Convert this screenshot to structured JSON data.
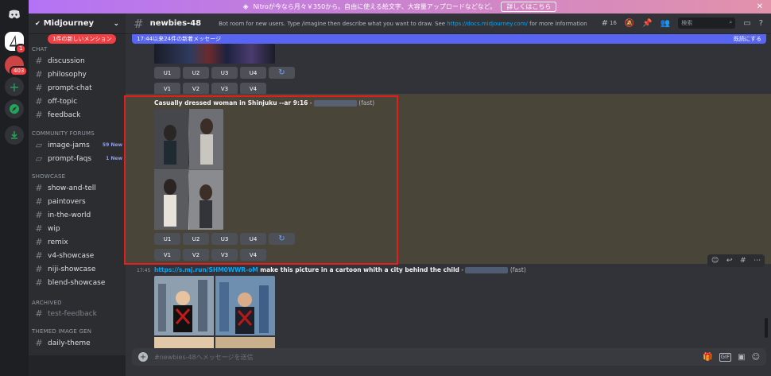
{
  "banner": {
    "nitro_icon": "nitro-icon",
    "text": "Nitroが今なら月々￥350から。自由に使える絵文字、大容量アップロードなどなど。",
    "cta": "詳しくはこちら",
    "close": "✕"
  },
  "guilds": {
    "badge_1": "1",
    "badge_2": "403"
  },
  "server": {
    "name": "Midjourney",
    "mention_pill": "1件の新しいメンション"
  },
  "sidebar": {
    "cat_chat": "CHAT",
    "ch_discussion": "discussion",
    "ch_philosophy": "philosophy",
    "ch_prompt_chat": "prompt-chat",
    "ch_off_topic": "off-topic",
    "ch_feedback": "feedback",
    "cat_forums": "COMMUNITY FORUMS",
    "ch_image_jams": "image-jams",
    "image_jams_new": "59 New",
    "ch_prompt_faqs": "prompt-faqs",
    "prompt_faqs_new": "1 New",
    "cat_showcase": "SHOWCASE",
    "ch_show_and_tell": "show-and-tell",
    "ch_paintovers": "paintovers",
    "ch_in_the_world": "in-the-world",
    "ch_wip": "wip",
    "ch_remix": "remix",
    "ch_v4_showcase": "v4-showcase",
    "ch_niji_showcase": "niji-showcase",
    "ch_blend_showcase": "blend-showcase",
    "cat_archived": "ARCHIVED",
    "ch_test_feedback": "test-feedback",
    "cat_themed": "THEMED IMAGE GEN",
    "ch_daily_theme": "daily-theme"
  },
  "channel": {
    "name": "newbies-48",
    "topic_pre": "Bot room for new users. Type /imagine then describe what you want to draw. See",
    "topic_link": "https://docs.midjourney.com/",
    "topic_post": "for more information",
    "thread_count": "16",
    "search_placeholder": "検索"
  },
  "newbar": {
    "text": "17:44以来24件の新着メッセージ",
    "mark_read": "既読にする"
  },
  "buttons": {
    "u1": "U1",
    "u2": "U2",
    "u3": "U3",
    "u4": "U4",
    "v1": "V1",
    "v2": "V2",
    "v3": "V3",
    "v4": "V4"
  },
  "msg1": {
    "prompt": "Casually dressed woman in Shinjuku --ar 9:16",
    "dash": "-",
    "fast": "(fast)"
  },
  "msg2": {
    "time": "17:45",
    "link": "https://s.mj.run/SHM0WWR-oM",
    "prompt": "make this picture in a cartoon whith a city behind the child",
    "dash": "-",
    "fast": "(fast)"
  },
  "composer": {
    "placeholder": "#newbies-48へメッセージを送信"
  },
  "colors": {
    "accent": "#5865f2",
    "highlight": "#4a4539",
    "red_box": "#e41e1e",
    "button": "#4e5058"
  }
}
